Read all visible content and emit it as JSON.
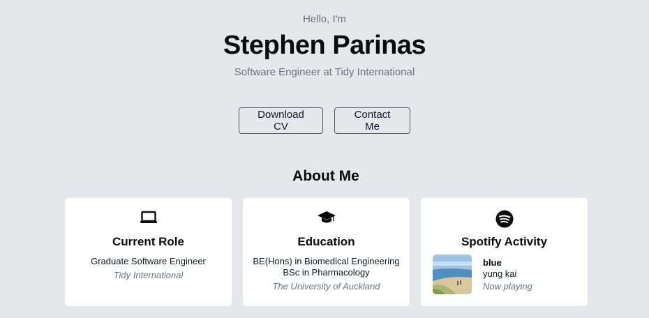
{
  "hero": {
    "greeting": "Hello, I'm",
    "name": "Stephen Parinas",
    "subtitle": "Software Engineer at Tidy International"
  },
  "actions": {
    "download_cv": "Download CV",
    "contact_me": "Contact Me"
  },
  "about": {
    "title": "About Me",
    "cards": {
      "role": {
        "icon": "laptop-icon",
        "title": "Current Role",
        "position": "Graduate Software Engineer",
        "company": "Tidy International"
      },
      "education": {
        "icon": "graduation-cap-icon",
        "title": "Education",
        "degree1": "BE(Hons) in Biomedical Engineering",
        "degree2": "BSc in Pharmacology",
        "school": "The University of Auckland"
      },
      "spotify": {
        "icon": "spotify-icon",
        "title": "Spotify Activity",
        "track": "blue",
        "artist": "yung kai",
        "status": "Now playing"
      }
    }
  },
  "colors": {
    "background": "#e5e7eb",
    "card": "#ffffff",
    "muted": "#6b7280",
    "text": "#0b0b0b"
  }
}
